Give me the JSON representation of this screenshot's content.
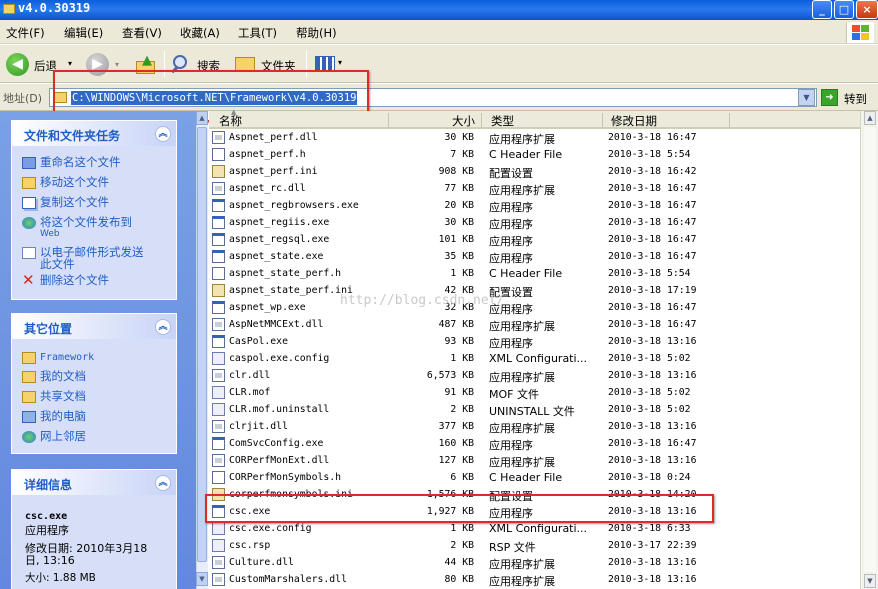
{
  "window": {
    "title": "v4.0.30319"
  },
  "menu": [
    "文件(F)",
    "编辑(E)",
    "查看(V)",
    "收藏(A)",
    "工具(T)",
    "帮助(H)"
  ],
  "toolbar": {
    "back": "后退",
    "search": "搜索",
    "folders": "文件夹"
  },
  "address": {
    "label": "地址(D)",
    "path": "C:\\WINDOWS\\Microsoft.NET\\Framework\\v4.0.30319",
    "go": "转到"
  },
  "sidebar": {
    "tasks": {
      "title": "文件和文件夹任务",
      "items": [
        "重命名这个文件",
        "移动这个文件",
        "复制这个文件",
        "将这个文件发布到",
        "Web",
        "以电子邮件形式发送",
        "此文件",
        "删除这个文件"
      ]
    },
    "places": {
      "title": "其它位置",
      "items": [
        "Framework",
        "我的文档",
        "共享文档",
        "我的电脑",
        "网上邻居"
      ]
    },
    "details": {
      "title": "详细信息",
      "name": "csc.exe",
      "type": "应用程序",
      "modified_label": "修改日期: 2010年3月18",
      "modified_time": "日, 13:16",
      "size": "大小: 1.88 MB"
    }
  },
  "columns": {
    "name": "名称",
    "size": "大小",
    "type": "类型",
    "date": "修改日期"
  },
  "files": [
    {
      "name": "Aspnet_perf.dll",
      "size": "30 KB",
      "type": "应用程序扩展",
      "date": "2010-3-18 16:47",
      "icon": "dll"
    },
    {
      "name": "aspnet_perf.h",
      "size": "7 KB",
      "type": "C Header File",
      "date": "2010-3-18 5:54",
      "icon": "h"
    },
    {
      "name": "aspnet_perf.ini",
      "size": "908 KB",
      "type": "配置设置",
      "date": "2010-3-18 16:42",
      "icon": "ini"
    },
    {
      "name": "aspnet_rc.dll",
      "size": "77 KB",
      "type": "应用程序扩展",
      "date": "2010-3-18 16:47",
      "icon": "dll"
    },
    {
      "name": "aspnet_regbrowsers.exe",
      "size": "20 KB",
      "type": "应用程序",
      "date": "2010-3-18 16:47",
      "icon": "exe"
    },
    {
      "name": "aspnet_regiis.exe",
      "size": "30 KB",
      "type": "应用程序",
      "date": "2010-3-18 16:47",
      "icon": "exe"
    },
    {
      "name": "aspnet_regsql.exe",
      "size": "101 KB",
      "type": "应用程序",
      "date": "2010-3-18 16:47",
      "icon": "exe"
    },
    {
      "name": "aspnet_state.exe",
      "size": "35 KB",
      "type": "应用程序",
      "date": "2010-3-18 16:47",
      "icon": "exe"
    },
    {
      "name": "aspnet_state_perf.h",
      "size": "1 KB",
      "type": "C Header File",
      "date": "2010-3-18 5:54",
      "icon": "h"
    },
    {
      "name": "aspnet_state_perf.ini",
      "size": "42 KB",
      "type": "配置设置",
      "date": "2010-3-18 17:19",
      "icon": "ini"
    },
    {
      "name": "aspnet_wp.exe",
      "size": "32 KB",
      "type": "应用程序",
      "date": "2010-3-18 16:47",
      "icon": "exe"
    },
    {
      "name": "AspNetMMCExt.dll",
      "size": "487 KB",
      "type": "应用程序扩展",
      "date": "2010-3-18 16:47",
      "icon": "dll"
    },
    {
      "name": "CasPol.exe",
      "size": "93 KB",
      "type": "应用程序",
      "date": "2010-3-18 13:16",
      "icon": "exe"
    },
    {
      "name": "caspol.exe.config",
      "size": "1 KB",
      "type": "XML Configurati...",
      "date": "2010-3-18 5:02",
      "icon": "cfg"
    },
    {
      "name": "clr.dll",
      "size": "6,573 KB",
      "type": "应用程序扩展",
      "date": "2010-3-18 13:16",
      "icon": "dll"
    },
    {
      "name": "CLR.mof",
      "size": "91 KB",
      "type": "MOF 文件",
      "date": "2010-3-18 5:02",
      "icon": "cfg"
    },
    {
      "name": "CLR.mof.uninstall",
      "size": "2 KB",
      "type": "UNINSTALL 文件",
      "date": "2010-3-18 5:02",
      "icon": "cfg"
    },
    {
      "name": "clrjit.dll",
      "size": "377 KB",
      "type": "应用程序扩展",
      "date": "2010-3-18 13:16",
      "icon": "dll"
    },
    {
      "name": "ComSvcConfig.exe",
      "size": "160 KB",
      "type": "应用程序",
      "date": "2010-3-18 16:47",
      "icon": "exe"
    },
    {
      "name": "CORPerfMonExt.dll",
      "size": "127 KB",
      "type": "应用程序扩展",
      "date": "2010-3-18 13:16",
      "icon": "dll"
    },
    {
      "name": "CORPerfMonSymbols.h",
      "size": "6 KB",
      "type": "C Header File",
      "date": "2010-3-18 0:24",
      "icon": "h"
    },
    {
      "name": "corperfmonsymbols.ini",
      "size": "1,576 KB",
      "type": "配置设置",
      "date": "2010-3-18 14:20",
      "icon": "ini"
    },
    {
      "name": "csc.exe",
      "size": "1,927 KB",
      "type": "应用程序",
      "date": "2010-3-18 13:16",
      "icon": "exe"
    },
    {
      "name": "csc.exe.config",
      "size": "1 KB",
      "type": "XML Configurati...",
      "date": "2010-3-18 6:33",
      "icon": "cfg"
    },
    {
      "name": "csc.rsp",
      "size": "2 KB",
      "type": "RSP 文件",
      "date": "2010-3-17 22:39",
      "icon": "cfg"
    },
    {
      "name": "Culture.dll",
      "size": "44 KB",
      "type": "应用程序扩展",
      "date": "2010-3-18 13:16",
      "icon": "dll"
    },
    {
      "name": "CustomMarshalers.dll",
      "size": "80 KB",
      "type": "应用程序扩展",
      "date": "2010-3-18 13:16",
      "icon": "dll"
    }
  ],
  "watermark": "http://blog.csdn.net/",
  "colors": {
    "highlight": "#316ac5",
    "annotation": "#e02a2a",
    "link": "#215dc6"
  }
}
